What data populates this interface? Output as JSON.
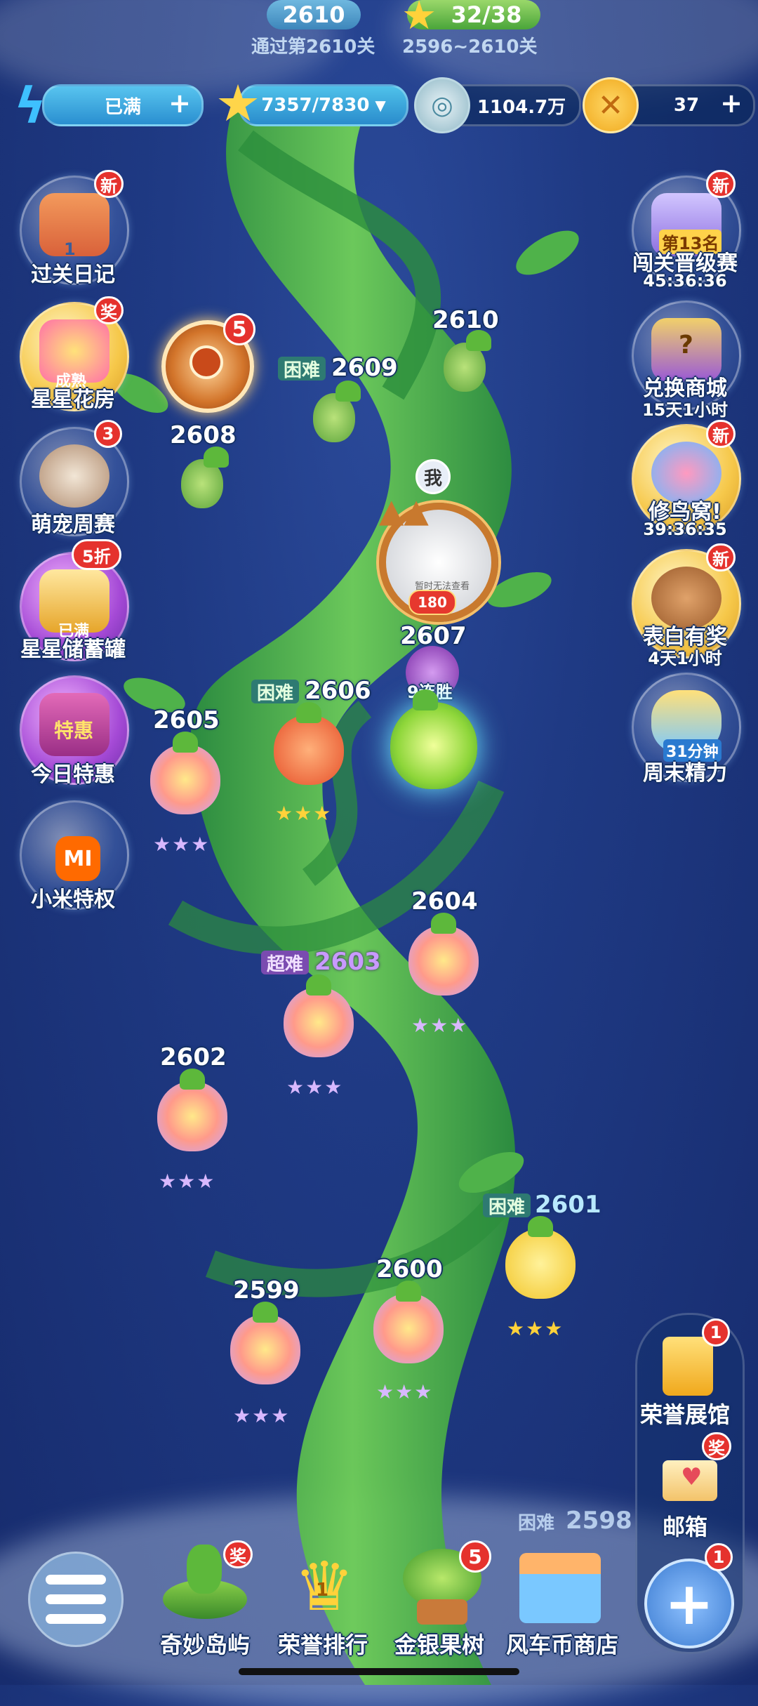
{
  "header": {
    "current_level": "2610",
    "passed_text": "通过第2610关",
    "stars_progress": "32/38",
    "stars_range": "2596~2610关"
  },
  "resources": {
    "energy": "已满",
    "star_points": "7357/7830",
    "coins": "1104.7万",
    "tokens": "37"
  },
  "left_menu": [
    {
      "label": "过关日记",
      "badge": "新",
      "art_text": "1"
    },
    {
      "label": "星星花房",
      "badge": "奖",
      "art_text": "成熟"
    },
    {
      "label": "萌宠周赛",
      "badge": "3",
      "art_text": ""
    },
    {
      "label": "星星储蓄罐",
      "badge": "5折",
      "art_text": "已满"
    },
    {
      "label": "今日特惠",
      "badge": "",
      "art_text": "特惠"
    },
    {
      "label": "小米特权",
      "badge": "",
      "art_text": "MI"
    }
  ],
  "right_menu": [
    {
      "label": "闯关晋级赛",
      "sub": "45:36:36",
      "badge": "新",
      "art_text": "第13名"
    },
    {
      "label": "兑换商城",
      "sub": "15天1小时",
      "badge": "",
      "art_text": "?"
    },
    {
      "label": "修鸟窝!",
      "sub": "39:36:35",
      "badge": "新",
      "art_text": ""
    },
    {
      "label": "表白有奖",
      "sub": "4天1小时",
      "badge": "新",
      "art_text": ""
    },
    {
      "label": "周末精力",
      "sub": "",
      "badge": "",
      "art_text": "31分钟"
    }
  ],
  "wheel_badge": "5",
  "player": {
    "me_label": "我",
    "avatar_caption": "暂时无法查看",
    "avatar_number": "180",
    "streak": "9连胜"
  },
  "levels": [
    {
      "num": "2610",
      "tag": "",
      "stars": ""
    },
    {
      "num": "2609",
      "tag": "困难",
      "stars": ""
    },
    {
      "num": "2608",
      "tag": "",
      "stars": ""
    },
    {
      "num": "2607",
      "tag": "",
      "stars": ""
    },
    {
      "num": "2606",
      "tag": "困难",
      "stars": "★★★"
    },
    {
      "num": "2605",
      "tag": "",
      "stars": "★★★"
    },
    {
      "num": "2604",
      "tag": "",
      "stars": "★★★"
    },
    {
      "num": "2603",
      "tag": "超难",
      "stars": "★★★"
    },
    {
      "num": "2602",
      "tag": "",
      "stars": "★★★"
    },
    {
      "num": "2601",
      "tag": "困难",
      "stars": "★★★"
    },
    {
      "num": "2600",
      "tag": "",
      "stars": "★★★"
    },
    {
      "num": "2599",
      "tag": "",
      "stars": "★★★"
    },
    {
      "num": "2598",
      "tag": "困难",
      "stars": ""
    }
  ],
  "side_panel": [
    {
      "label": "荣誉展馆",
      "badge": "1"
    },
    {
      "label": "邮箱",
      "badge": "奖"
    },
    {
      "label": "",
      "badge": "1"
    }
  ],
  "bottom_nav": [
    {
      "label": "奇妙岛屿",
      "badge": "奖"
    },
    {
      "label": "荣誉排行",
      "badge": "",
      "art_text": "1"
    },
    {
      "label": "金银果树",
      "badge": "5"
    },
    {
      "label": "风车币商店",
      "badge": ""
    }
  ],
  "colors": {
    "hard_tag": "#2e7a72",
    "super_hard_tag": "#7a4bb0",
    "vine": "#3fa845",
    "sky": "#1f3a84"
  }
}
